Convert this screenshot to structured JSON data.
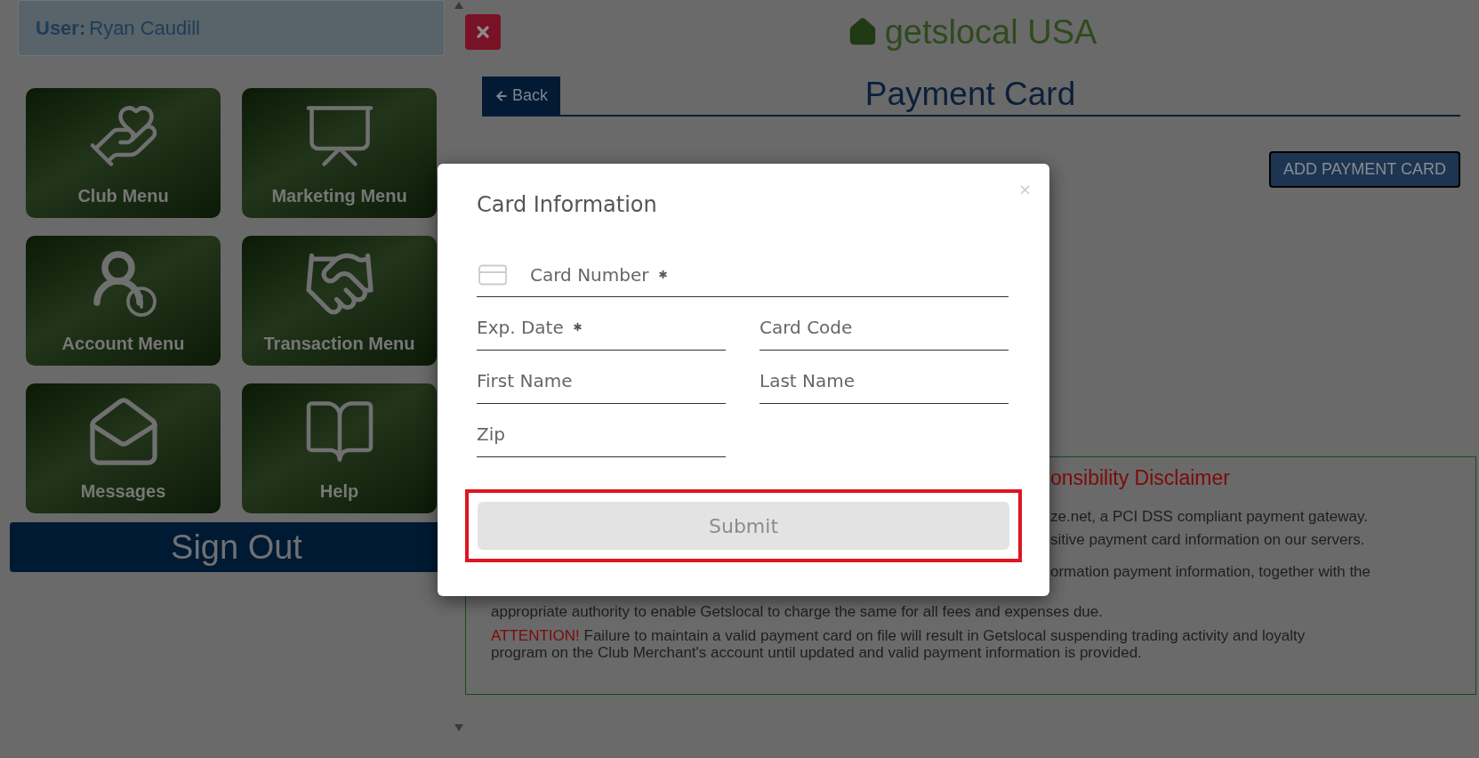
{
  "user": {
    "label": "User:",
    "name": "Ryan Caudill"
  },
  "menu_tiles": [
    {
      "label": "Club Menu",
      "kind": "club"
    },
    {
      "label": "Marketing Menu",
      "kind": "marketing"
    },
    {
      "label": "Account Menu",
      "kind": "account"
    },
    {
      "label": "Transaction Menu",
      "kind": "transaction"
    },
    {
      "label": "Messages",
      "kind": "messages"
    },
    {
      "label": "Help",
      "kind": "help"
    }
  ],
  "sign_out": "Sign Out",
  "brand": "getslocal USA",
  "back_button": "Back",
  "page_title": "Payment Card",
  "add_button": "ADD PAYMENT CARD",
  "disclaimer": {
    "title": "onsibility Disclaimer",
    "covered_lines": [
      "ze.net, a PCI DSS compliant payment gateway.",
      "sitive payment card information on our servers.",
      "ormation payment information, together with the"
    ],
    "line": "appropriate authority to enable Getslocal to charge the same for all fees and expenses due.",
    "attention_label": "ATTENTION!",
    "attention_text": "Failure to maintain a valid payment card on file will result in Getslocal suspending trading activity and loyalty program on the Club Merchant's account until updated and valid payment information is provided."
  },
  "modal": {
    "title": "Card Information",
    "close": "×",
    "fields": [
      {
        "placeholder": "Card Number",
        "required": true,
        "kind": "card"
      },
      {
        "placeholder": "Exp. Date",
        "required": true,
        "kind": "text"
      },
      {
        "placeholder": "Card Code",
        "required": false,
        "kind": "text"
      },
      {
        "placeholder": "First Name",
        "required": false,
        "kind": "text"
      },
      {
        "placeholder": "Last Name",
        "required": false,
        "kind": "text"
      },
      {
        "placeholder": "Zip",
        "required": false,
        "kind": "text"
      }
    ],
    "submit": {
      "label": "Submit",
      "highlighted": true
    }
  }
}
